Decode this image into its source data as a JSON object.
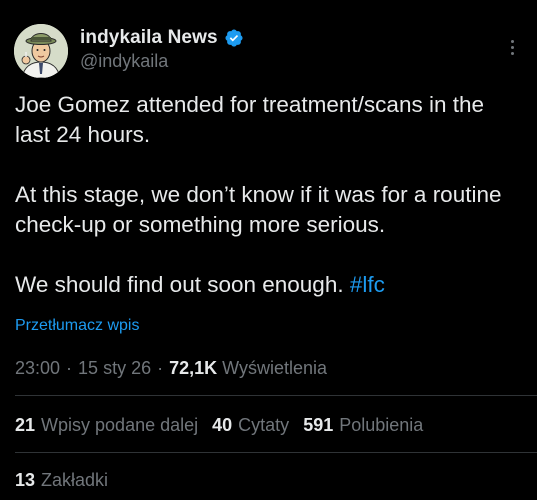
{
  "author": {
    "display_name": "indykaila News",
    "handle": "@indykaila",
    "verified_color": "#1d9bf0",
    "avatar_icon": "cartoon-man-with-hat-avatar"
  },
  "tweet": {
    "line1": "Joe Gomez attended for treatment/scans in the last 24 hours.",
    "line2": "At this stage, we don’t know if it was for a routine check-up or something more serious.",
    "line3_text": "We should find out soon enough. ",
    "hashtag": "#lfc"
  },
  "translate_label": "Przetłumacz wpis",
  "meta": {
    "time": "23:00",
    "date": "15 sty 26",
    "views_count": "72,1K",
    "views_label": "Wyświetlenia",
    "separator": "·"
  },
  "stats": {
    "reposts_count": "21",
    "reposts_label": "Wpisy podane dalej",
    "quotes_count": "40",
    "quotes_label": "Cytaty",
    "likes_count": "591",
    "likes_label": "Polubienia",
    "bookmarks_count": "13",
    "bookmarks_label": "Zakładki"
  },
  "colors": {
    "background": "#000000",
    "text": "#e7e9ea",
    "secondary": "#71767b",
    "link": "#1d9bf0",
    "divider": "#2f3336"
  }
}
